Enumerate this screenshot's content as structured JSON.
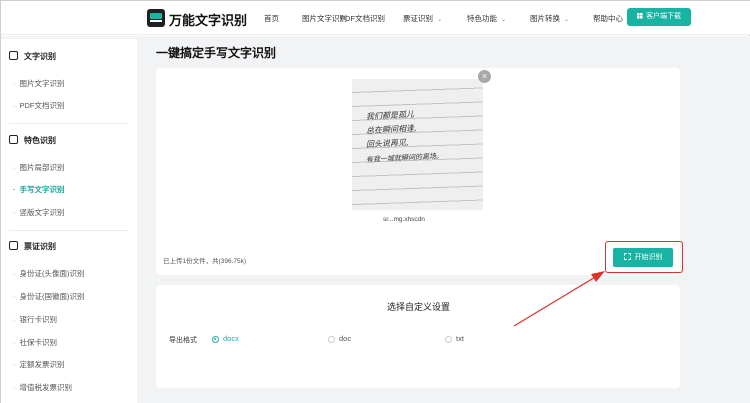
{
  "header": {
    "brand": "万能文字识别",
    "nav": [
      {
        "label": "首页",
        "dropdown": false
      },
      {
        "label": "图片文字识别",
        "dropdown": false
      },
      {
        "label": "PDF文档识别",
        "dropdown": false
      },
      {
        "label": "票证识别",
        "dropdown": true
      },
      {
        "label": "特色功能",
        "dropdown": true
      },
      {
        "label": "图片转换",
        "dropdown": true
      },
      {
        "label": "帮助中心",
        "dropdown": false
      }
    ],
    "download_label": "客户端下载"
  },
  "sidebar": {
    "groups": [
      {
        "title": "文字识别",
        "icon": "text-scan-icon",
        "items": [
          {
            "label": "图片文字识别",
            "active": false
          },
          {
            "label": "PDF文档识别",
            "active": false
          }
        ]
      },
      {
        "title": "特色识别",
        "icon": "special-scan-icon",
        "items": [
          {
            "label": "图片局部识别",
            "active": false
          },
          {
            "label": "手写文字识别",
            "active": true
          },
          {
            "label": "竖版文字识别",
            "active": false
          }
        ]
      },
      {
        "title": "票证识别",
        "icon": "ticket-icon",
        "items": [
          {
            "label": "身份证(头像面)识别",
            "active": false
          },
          {
            "label": "身份证(国徽面)识别",
            "active": false
          },
          {
            "label": "银行卡识别",
            "active": false
          },
          {
            "label": "社保卡识别",
            "active": false
          },
          {
            "label": "定额发票识别",
            "active": false
          },
          {
            "label": "增值税发票识别",
            "active": false
          }
        ]
      }
    ]
  },
  "main": {
    "page_title": "一键搞定手写文字识别",
    "preview_handwriting": [
      "我们都是孤儿",
      "总在瞬间相逢,",
      "回头说再见,",
      "有我一城就瞬间的离场。"
    ],
    "filename": "sr...mg.xhscdn",
    "status": "已上传1份文件，共(396.75k)",
    "start_button": "开始识别",
    "settings_title": "选择自定义设置",
    "format_label": "导出格式",
    "formats": [
      {
        "label": "docx",
        "selected": true
      },
      {
        "label": "doc",
        "selected": false
      },
      {
        "label": "txt",
        "selected": false
      }
    ]
  },
  "colors": {
    "accent": "#18b3a3",
    "annotation_red": "#d9342b"
  }
}
